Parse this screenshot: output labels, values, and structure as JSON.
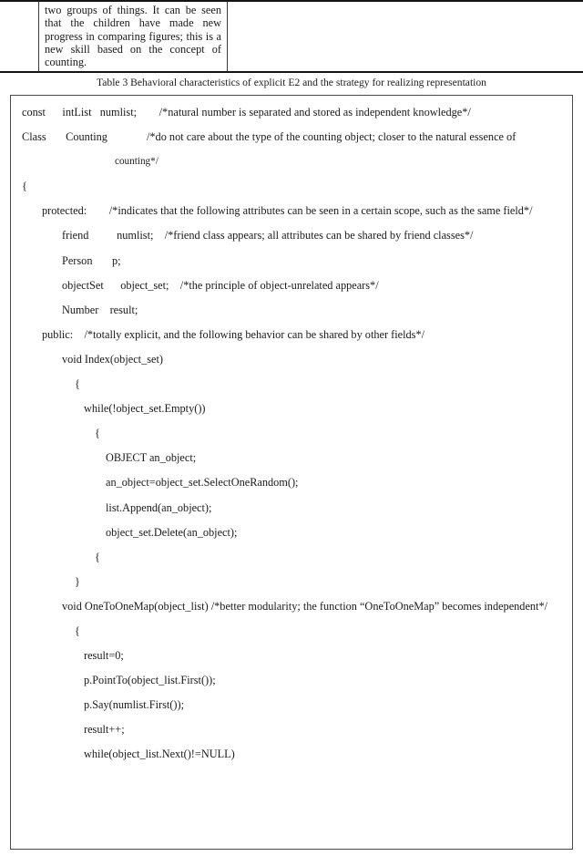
{
  "document": {
    "top_table": {
      "paragraph": "two groups of things. It can be seen that the children have made new progress in comparing figures; this is a new skill based on the concept of counting."
    },
    "caption": "Table 3 Behavioral characteristics of explicit E2 and the strategy for realizing representation",
    "code_block": {
      "lines": [
        {
          "indent": "i0",
          "text": "const      intList   numlist;        /*natural number is separated and stored as independent knowledge*/"
        },
        {
          "indent": "i0",
          "text": "Class       Counting              /*do not care about the type of the counting object; closer to the natural essence of"
        },
        {
          "indent": "cont",
          "text": "counting*/"
        },
        {
          "indent": "i0",
          "text": "{"
        },
        {
          "indent": "i1",
          "text": "protected:        /*indicates that the following attributes can be seen in a certain scope, such as the same field*/"
        },
        {
          "indent": "i2",
          "text": "friend          numlist;    /*friend class appears; all attributes can be shared by friend classes*/"
        },
        {
          "indent": "i2",
          "text": "Person       p;"
        },
        {
          "indent": "i2",
          "text": "objectSet      object_set;    /*the principle of object-unrelated appears*/"
        },
        {
          "indent": "i2",
          "text": "Number    result;"
        },
        {
          "indent": "i0",
          "text": ""
        },
        {
          "indent": "i1",
          "text": "public:    /*totally explicit, and the following behavior can be shared by other fields*/"
        },
        {
          "indent": "i2",
          "text": "void Index(object_set)"
        },
        {
          "indent": "i3",
          "text": "{"
        },
        {
          "indent": "i4",
          "text": "while(!object_set.Empty())"
        },
        {
          "indent": "i5",
          "text": "{"
        },
        {
          "indent": "i6",
          "text": "OBJECT an_object;"
        },
        {
          "indent": "i6",
          "text": "an_object=object_set.SelectOneRandom();"
        },
        {
          "indent": "i6",
          "text": "list.Append(an_object);"
        },
        {
          "indent": "i6",
          "text": "object_set.Delete(an_object);"
        },
        {
          "indent": "i5",
          "text": "{"
        },
        {
          "indent": "i3",
          "text": "}"
        },
        {
          "indent": "i2",
          "text": "void OneToOneMap(object_list) /*better modularity; the function “OneToOneMap” becomes independent*/"
        },
        {
          "indent": "i3",
          "text": "{"
        },
        {
          "indent": "i4",
          "text": "result=0;"
        },
        {
          "indent": "i4",
          "text": "p.PointTo(object_list.First());"
        },
        {
          "indent": "i4",
          "text": "p.Say(numlist.First());"
        },
        {
          "indent": "i4",
          "text": "result++;"
        },
        {
          "indent": "i4",
          "text": "while(object_list.Next()!=NULL)"
        }
      ]
    }
  },
  "colors": {
    "text": "#1a1a1a",
    "rule": "#141414",
    "box_border": "#4a4a4a",
    "page_background": "#ffffff"
  }
}
